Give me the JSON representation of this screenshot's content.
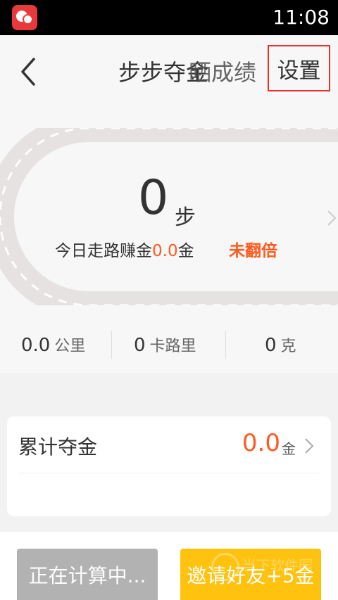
{
  "status_bar": {
    "time": "11:08"
  },
  "header": {
    "title": "步步夺金",
    "title_overlap": "晒成绩",
    "settings_label": "设置"
  },
  "today": {
    "steps": "0",
    "steps_unit": "步",
    "earn_prefix": "今日走路赚金",
    "earn_value": "0.0",
    "earn_unit": "金",
    "double_status": "未翻倍"
  },
  "stats": [
    {
      "value": "0.0",
      "unit": "公里"
    },
    {
      "value": "0",
      "unit": "卡路里"
    },
    {
      "value": "0",
      "unit": "克"
    }
  ],
  "total_gold": {
    "label": "累计夺金",
    "value": "0.0",
    "unit": "金"
  },
  "buttons": {
    "calculating": "正在计算中...",
    "invite": "邀请好友+5金"
  },
  "watermark": {
    "text": "当下软件园"
  },
  "colors": {
    "accent": "#ff5a1f",
    "invite_bg": "#ffc20e",
    "disabled_bg": "#b2b2b2",
    "highlight_border": "#e5302f"
  }
}
